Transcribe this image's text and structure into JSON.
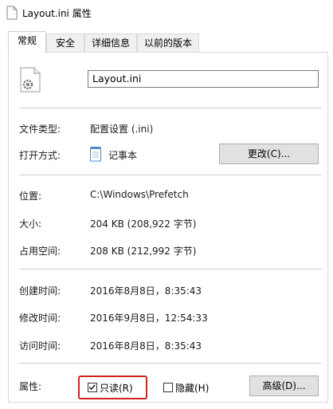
{
  "window": {
    "title": "Layout.ini 属性"
  },
  "tabs": [
    {
      "label": "常规"
    },
    {
      "label": "安全"
    },
    {
      "label": "详细信息"
    },
    {
      "label": "以前的版本"
    }
  ],
  "file": {
    "name": "Layout.ini",
    "icon": "settings-file-icon"
  },
  "fields": {
    "type_label": "文件类型:",
    "type_value": "配置设置 (.ini)",
    "open_label": "打开方式:",
    "open_value": "记事本",
    "change_button": "更改(C)...",
    "location_label": "位置:",
    "location_value": "C:\\Windows\\Prefetch",
    "size_label": "大小:",
    "size_value": "204 KB (208,922 字节)",
    "disk_label": "占用空间:",
    "disk_value": "208 KB (212,992 字节)",
    "created_label": "创建时间:",
    "created_value": "2016年8月8日，8:35:43",
    "modified_label": "修改时间:",
    "modified_value": "2016年9月8日，12:54:33",
    "accessed_label": "访问时间:",
    "accessed_value": "2016年8月8日，8:35:43",
    "attr_label": "属性:",
    "readonly_label": "只读(R)",
    "readonly_checked": true,
    "hidden_label": "隐藏(H)",
    "hidden_checked": false,
    "advanced_button": "高级(D)..."
  },
  "colors": {
    "highlight": "#d32020",
    "accent": "#0078d7"
  }
}
